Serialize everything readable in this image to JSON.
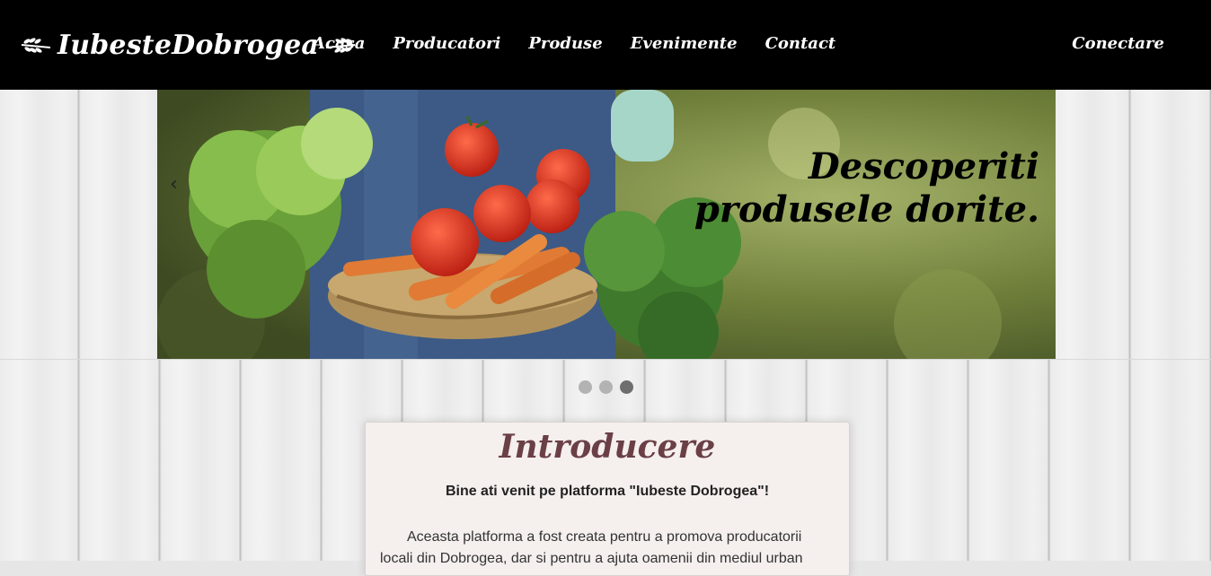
{
  "brand": {
    "name": "IubesteDobrogea",
    "icon": "wheat-sprig-icon"
  },
  "nav": {
    "items": [
      {
        "label": "Acasa"
      },
      {
        "label": "Producatori"
      },
      {
        "label": "Produse"
      },
      {
        "label": "Evenimente"
      },
      {
        "label": "Contact"
      }
    ],
    "login": "Conectare"
  },
  "carousel": {
    "caption_line1": "Descoperiti",
    "caption_line2": "produsele dorite.",
    "prev_symbol": "‹",
    "slides": 3,
    "active_slide": 3
  },
  "intro": {
    "title": "Introducere",
    "subtitle": "Bine ati venit pe platforma \"Iubeste Dobrogea\"!",
    "body": "Aceasta platforma a fost creata pentru a promova producatorii locali din Dobrogea, dar si pentru a ajuta oamenii din mediul urban"
  },
  "colors": {
    "navbar": "#000000",
    "title": "#6a3f45",
    "panel": "#f5efee",
    "dot_active": "#6e6e6e",
    "dot_inactive": "#b3b3b3"
  }
}
